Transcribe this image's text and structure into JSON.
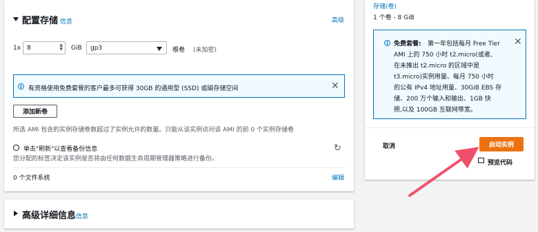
{
  "storage": {
    "title": "配置存储",
    "info_link": "信息",
    "advanced_link": "高级",
    "volume_count_prefix": "1x",
    "volume_size": "8",
    "unit": "GiB",
    "volume_type": "gp3",
    "volume_kind": "根卷",
    "encryption": "(未加密)",
    "free_tier_notice": "有资格使用免费套餐的客户最多可获得 30GB 的通用型 (SSD) 或磁存储空间",
    "add_volume_button": "添加新卷",
    "ami_note": "所选 AMI 包含的实例存储卷数超过了实例允许的数量。只能从该实例访问该 AMI 的前 0 个实例存储卷",
    "backup_title": "单击\"刷新\"以查看备份信息",
    "backup_desc": "您分配的标签决定该实例是否将由任何数据生命周期管理器策略进行备份。",
    "filesystems": "0 个文件系统",
    "edit_link": "编辑"
  },
  "advanced": {
    "title": "高级详细信息",
    "info_link": "信息"
  },
  "summary": {
    "storage_link": "存储(卷)",
    "storage_value": "1 个卷 - 8 GiB",
    "free_tier_label": "免费套餐:",
    "free_tier_lines": [
      "第一年包括每月 Free Tier",
      "AMI 上的 750 小时 t2.micro(或者,",
      "在未推出 t2.micro 的区域中是",
      "t3.micro)实例用量、每月 750 小时",
      "的公有 IPv4 地址用量、30GiB EBS 存",
      "储、200 万个输入和输出、1GB 快",
      "照,以及 100GB 互联网带宽。"
    ],
    "cancel": "取消",
    "launch": "启动实例",
    "preview_code": "预览代码"
  },
  "colors": {
    "accent": "#0073bb",
    "launch": "#ec7211",
    "annotation_arrow": "#f0506e"
  }
}
